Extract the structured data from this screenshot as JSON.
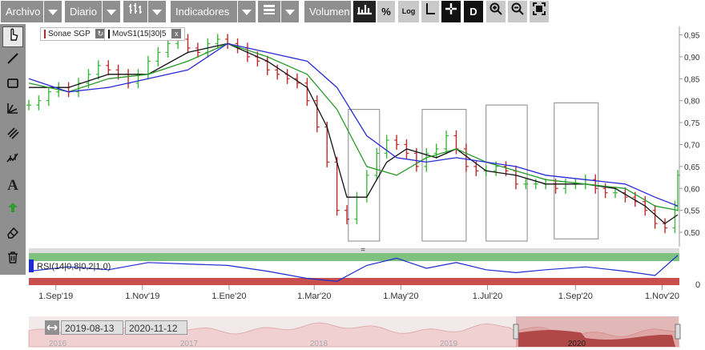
{
  "toolbar": {
    "archivo": "Archivo",
    "diario": "Diario",
    "indicadores": "Indicadores",
    "volumen": "Volumen",
    "percent": "%",
    "log": "Log",
    "d": "D"
  },
  "legend": {
    "series": "Sonae SGP",
    "indicator": "MovS1(15|30|5",
    "close": "x"
  },
  "rsi": {
    "label": "RSI(14|0,8|0,2|1,0)",
    "axis_label": "0"
  },
  "splitter": "=",
  "navigator": {
    "from": "2019-08-13",
    "to": "2020-11-12",
    "years": [
      "2016",
      "2017",
      "2018",
      "2019",
      "2020"
    ]
  },
  "colors": {
    "up": "#3cb83c",
    "down": "#c0282a",
    "ma_fast": "#111111",
    "ma_mid": "#2a2ad8",
    "ma_slow": "#2a9a2a",
    "rsi_line": "#1d2bd0",
    "rsi_high": "#7fc27f",
    "rsi_low": "#c94f4f"
  },
  "chart_data": {
    "type": "line",
    "title": "Sonae SGP",
    "x_tick_labels": [
      "1.Sep'19",
      "1.Nov'19",
      "1.Ene'20",
      "1.Mar'20",
      "1.May'20",
      "1.Jul'20",
      "1.Sep'20",
      "1.Nov'20"
    ],
    "y_tick_labels": [
      "0,95",
      "0,90",
      "0,85",
      "0,80",
      "0,75",
      "0,70",
      "0,65",
      "0,60",
      "0,55",
      "0,50"
    ],
    "ylim": [
      0.48,
      0.96
    ],
    "series": [
      {
        "name": "Sonae SGP",
        "style": "ohlc",
        "points": [
          [
            "2019-08-13",
            0.79
          ],
          [
            "2019-08-20",
            0.8
          ],
          [
            "2019-08-27",
            0.82
          ],
          [
            "2019-09-03",
            0.83
          ],
          [
            "2019-09-10",
            0.82
          ],
          [
            "2019-09-17",
            0.84
          ],
          [
            "2019-09-24",
            0.86
          ],
          [
            "2019-10-01",
            0.88
          ],
          [
            "2019-10-08",
            0.87
          ],
          [
            "2019-10-15",
            0.86
          ],
          [
            "2019-10-22",
            0.84
          ],
          [
            "2019-10-29",
            0.86
          ],
          [
            "2019-11-05",
            0.89
          ],
          [
            "2019-11-12",
            0.91
          ],
          [
            "2019-11-19",
            0.93
          ],
          [
            "2019-11-26",
            0.94
          ],
          [
            "2019-12-03",
            0.92
          ],
          [
            "2019-12-10",
            0.91
          ],
          [
            "2019-12-17",
            0.93
          ],
          [
            "2019-12-24",
            0.94
          ],
          [
            "2019-12-31",
            0.93
          ],
          [
            "2020-01-07",
            0.92
          ],
          [
            "2020-01-14",
            0.9
          ],
          [
            "2020-01-21",
            0.89
          ],
          [
            "2020-01-28",
            0.87
          ],
          [
            "2020-02-04",
            0.86
          ],
          [
            "2020-02-11",
            0.85
          ],
          [
            "2020-02-18",
            0.84
          ],
          [
            "2020-02-25",
            0.8
          ],
          [
            "2020-03-03",
            0.74
          ],
          [
            "2020-03-10",
            0.66
          ],
          [
            "2020-03-17",
            0.55
          ],
          [
            "2020-03-24",
            0.53
          ],
          [
            "2020-03-31",
            0.58
          ],
          [
            "2020-04-07",
            0.63
          ],
          [
            "2020-04-14",
            0.68
          ],
          [
            "2020-04-21",
            0.71
          ],
          [
            "2020-04-28",
            0.7
          ],
          [
            "2020-05-05",
            0.68
          ],
          [
            "2020-05-12",
            0.65
          ],
          [
            "2020-05-19",
            0.68
          ],
          [
            "2020-05-26",
            0.69
          ],
          [
            "2020-06-02",
            0.72
          ],
          [
            "2020-06-09",
            0.69
          ],
          [
            "2020-06-16",
            0.65
          ],
          [
            "2020-06-23",
            0.64
          ],
          [
            "2020-06-30",
            0.64
          ],
          [
            "2020-07-07",
            0.65
          ],
          [
            "2020-07-14",
            0.64
          ],
          [
            "2020-07-21",
            0.61
          ],
          [
            "2020-07-28",
            0.61
          ],
          [
            "2020-08-04",
            0.61
          ],
          [
            "2020-08-11",
            0.61
          ],
          [
            "2020-08-18",
            0.6
          ],
          [
            "2020-08-25",
            0.61
          ],
          [
            "2020-09-01",
            0.61
          ],
          [
            "2020-09-08",
            0.62
          ],
          [
            "2020-09-15",
            0.6
          ],
          [
            "2020-09-22",
            0.59
          ],
          [
            "2020-09-29",
            0.59
          ],
          [
            "2020-10-06",
            0.58
          ],
          [
            "2020-10-13",
            0.57
          ],
          [
            "2020-10-20",
            0.55
          ],
          [
            "2020-10-27",
            0.52
          ],
          [
            "2020-11-03",
            0.51
          ],
          [
            "2020-11-10",
            0.56
          ],
          [
            "2020-11-12",
            0.63
          ]
        ]
      },
      {
        "name": "MovS1(15)",
        "points": [
          [
            "2019-08-13",
            0.83
          ],
          [
            "2019-09-10",
            0.83
          ],
          [
            "2019-10-08",
            0.86
          ],
          [
            "2019-11-05",
            0.86
          ],
          [
            "2019-12-03",
            0.91
          ],
          [
            "2019-12-31",
            0.93
          ],
          [
            "2020-01-28",
            0.89
          ],
          [
            "2020-02-25",
            0.83
          ],
          [
            "2020-03-10",
            0.74
          ],
          [
            "2020-03-24",
            0.58
          ],
          [
            "2020-04-07",
            0.58
          ],
          [
            "2020-04-21",
            0.66
          ],
          [
            "2020-05-05",
            0.69
          ],
          [
            "2020-05-26",
            0.67
          ],
          [
            "2020-06-09",
            0.69
          ],
          [
            "2020-06-30",
            0.64
          ],
          [
            "2020-07-21",
            0.63
          ],
          [
            "2020-08-11",
            0.61
          ],
          [
            "2020-09-08",
            0.61
          ],
          [
            "2020-09-29",
            0.6
          ],
          [
            "2020-10-20",
            0.56
          ],
          [
            "2020-11-03",
            0.52
          ],
          [
            "2020-11-12",
            0.54
          ]
        ]
      },
      {
        "name": "MovS1(30)",
        "points": [
          [
            "2019-08-13",
            0.84
          ],
          [
            "2019-09-10",
            0.82
          ],
          [
            "2019-10-08",
            0.85
          ],
          [
            "2019-11-05",
            0.86
          ],
          [
            "2019-12-03",
            0.89
          ],
          [
            "2019-12-31",
            0.93
          ],
          [
            "2020-01-28",
            0.9
          ],
          [
            "2020-02-25",
            0.86
          ],
          [
            "2020-03-17",
            0.78
          ],
          [
            "2020-04-07",
            0.65
          ],
          [
            "2020-04-28",
            0.63
          ],
          [
            "2020-05-19",
            0.67
          ],
          [
            "2020-06-09",
            0.69
          ],
          [
            "2020-06-30",
            0.66
          ],
          [
            "2020-07-21",
            0.64
          ],
          [
            "2020-08-11",
            0.62
          ],
          [
            "2020-09-08",
            0.61
          ],
          [
            "2020-10-06",
            0.6
          ],
          [
            "2020-10-27",
            0.56
          ],
          [
            "2020-11-12",
            0.55
          ]
        ]
      },
      {
        "name": "MovS1(5)",
        "points": [
          [
            "2019-08-13",
            0.85
          ],
          [
            "2019-09-10",
            0.82
          ],
          [
            "2019-10-08",
            0.83
          ],
          [
            "2019-11-05",
            0.85
          ],
          [
            "2019-12-03",
            0.87
          ],
          [
            "2019-12-31",
            0.93
          ],
          [
            "2020-01-28",
            0.91
          ],
          [
            "2020-02-25",
            0.89
          ],
          [
            "2020-03-17",
            0.83
          ],
          [
            "2020-04-07",
            0.72
          ],
          [
            "2020-04-28",
            0.67
          ],
          [
            "2020-05-19",
            0.66
          ],
          [
            "2020-06-09",
            0.67
          ],
          [
            "2020-06-30",
            0.66
          ],
          [
            "2020-07-21",
            0.65
          ],
          [
            "2020-08-11",
            0.63
          ],
          [
            "2020-09-08",
            0.62
          ],
          [
            "2020-10-06",
            0.61
          ],
          [
            "2020-10-27",
            0.58
          ],
          [
            "2020-11-12",
            0.56
          ]
        ]
      }
    ],
    "rsi": {
      "name": "RSI(14)",
      "points": [
        [
          "2019-08-13",
          0.4
        ],
        [
          "2019-09-10",
          0.55
        ],
        [
          "2019-10-08",
          0.45
        ],
        [
          "2019-11-05",
          0.7
        ],
        [
          "2019-12-03",
          0.65
        ],
        [
          "2019-12-31",
          0.6
        ],
        [
          "2020-01-28",
          0.4
        ],
        [
          "2020-02-25",
          0.15
        ],
        [
          "2020-03-17",
          0.05
        ],
        [
          "2020-04-07",
          0.6
        ],
        [
          "2020-04-28",
          0.85
        ],
        [
          "2020-05-19",
          0.5
        ],
        [
          "2020-06-09",
          0.7
        ],
        [
          "2020-06-30",
          0.45
        ],
        [
          "2020-07-21",
          0.35
        ],
        [
          "2020-08-11",
          0.45
        ],
        [
          "2020-09-08",
          0.55
        ],
        [
          "2020-10-06",
          0.4
        ],
        [
          "2020-10-27",
          0.25
        ],
        [
          "2020-11-12",
          0.95
        ]
      ]
    },
    "grid": false
  }
}
